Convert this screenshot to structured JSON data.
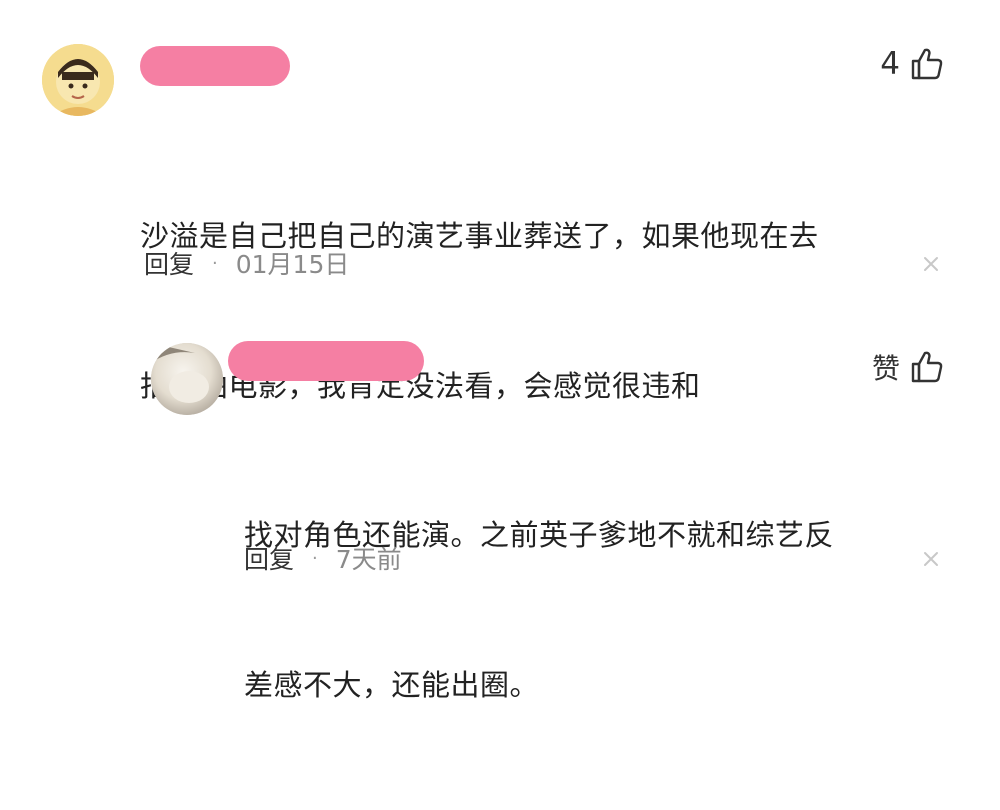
{
  "colors": {
    "name_redaction": "#f57fa3",
    "text": "#222222",
    "meta_time": "#8a8a8a",
    "icon": "#333333",
    "close_icon": "#c8c8c8"
  },
  "comments": [
    {
      "like_label": "4",
      "text_line1": "沙溢是自己把自己的演艺事业葬送了，如果他现在去",
      "text_line2": "拍戏拍电影，我肯定没法看，会感觉很违和",
      "reply_label": "回复",
      "separator": "·",
      "time": "01月15日",
      "icons": [
        "thumbs-up-icon",
        "close-icon"
      ]
    },
    {
      "like_label": "赞",
      "text_line1": "找对角色还能演。之前英子爹地不就和综艺反",
      "text_line2": "差感不大，还能出圈。",
      "reply_label": "回复",
      "separator": "·",
      "time": "7天前",
      "icons": [
        "thumbs-up-icon",
        "close-icon"
      ]
    }
  ]
}
